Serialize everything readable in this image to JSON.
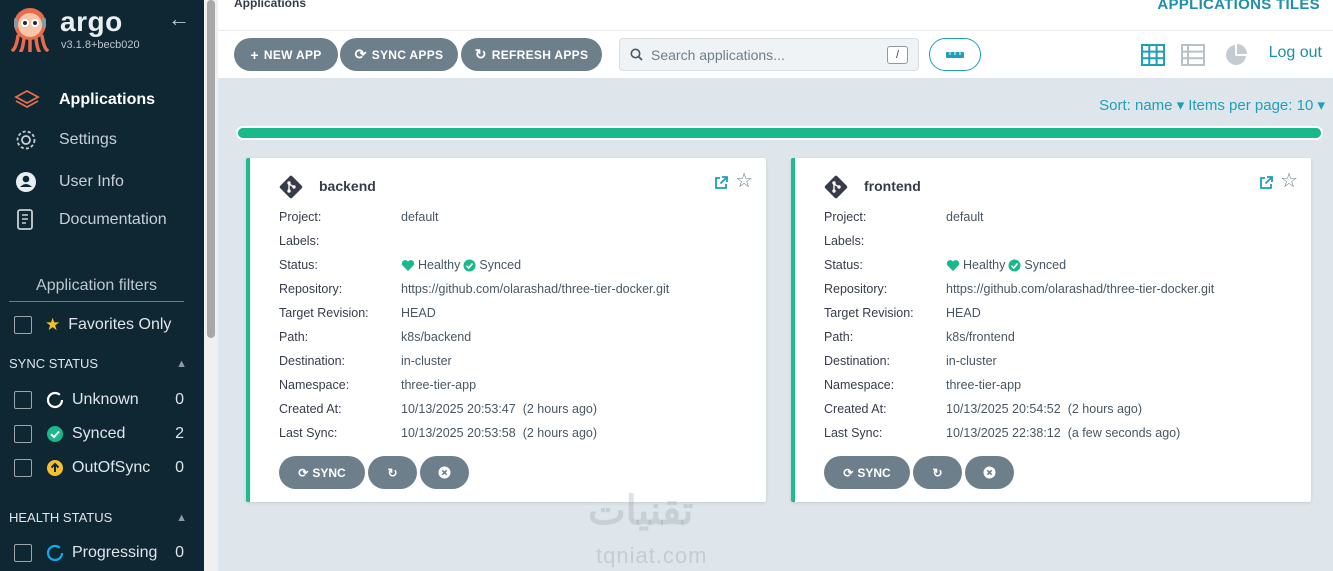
{
  "brand": {
    "name": "argo",
    "version": "v3.1.8+becb020"
  },
  "nav": [
    {
      "label": "Applications",
      "icon": "layers-icon",
      "active": true
    },
    {
      "label": "Settings",
      "icon": "gear-icon",
      "active": false
    },
    {
      "label": "User Info",
      "icon": "user-icon",
      "active": false
    },
    {
      "label": "Documentation",
      "icon": "book-icon",
      "active": false
    }
  ],
  "filters": {
    "title": "Application filters",
    "favorites_label": "Favorites Only",
    "sync_status": {
      "heading": "SYNC STATUS",
      "items": [
        {
          "label": "Unknown",
          "count": "0"
        },
        {
          "label": "Synced",
          "count": "2"
        },
        {
          "label": "OutOfSync",
          "count": "0"
        }
      ]
    },
    "health_status": {
      "heading": "HEALTH STATUS",
      "items": [
        {
          "label": "Progressing",
          "count": "0"
        }
      ]
    }
  },
  "header": {
    "breadcrumb": "Applications",
    "title": "APPLICATIONS TILES",
    "logout": "Log out"
  },
  "toolbar": {
    "new_app": "NEW APP",
    "sync_apps": "SYNC APPS",
    "refresh_apps": "REFRESH APPS",
    "search_placeholder": "Search applications...",
    "search_shortcut": "/"
  },
  "sort": {
    "sort_label": "Sort: name",
    "items_label": "Items per page: 10"
  },
  "progress": {
    "healthy_fraction": 1.0
  },
  "card_labels": {
    "project": "Project:",
    "labels": "Labels:",
    "status": "Status:",
    "repository": "Repository:",
    "target_revision": "Target Revision:",
    "path": "Path:",
    "destination": "Destination:",
    "namespace": "Namespace:",
    "created_at": "Created At:",
    "last_sync": "Last Sync:",
    "sync_button": "SYNC"
  },
  "apps": [
    {
      "name": "backend",
      "project": "default",
      "labels": "",
      "health": "Healthy",
      "sync": "Synced",
      "repository": "https://github.com/olarashad/three-tier-docker.git",
      "target_revision": "HEAD",
      "path": "k8s/backend",
      "destination": "in-cluster",
      "namespace": "three-tier-app",
      "created_at": "10/13/2025 20:53:47",
      "created_ago": "(2 hours ago)",
      "last_sync": "10/13/2025 20:53:58",
      "last_sync_ago": "(2 hours ago)"
    },
    {
      "name": "frontend",
      "project": "default",
      "labels": "",
      "health": "Healthy",
      "sync": "Synced",
      "repository": "https://github.com/olarashad/three-tier-docker.git",
      "target_revision": "HEAD",
      "path": "k8s/frontend",
      "destination": "in-cluster",
      "namespace": "three-tier-app",
      "created_at": "10/13/2025 20:54:52",
      "created_ago": "(2 hours ago)",
      "last_sync": "10/13/2025 22:38:12",
      "last_sync_ago": "(a few seconds ago)"
    }
  ],
  "watermark": {
    "text": "تقنيات",
    "subtext": "tqniat.com"
  },
  "colors": {
    "sidebar": "#0f2733",
    "accent": "#1f9fb8",
    "healthy": "#19b98c",
    "button": "#6d7f8b",
    "out_of_sync": "#f4c030",
    "progressing": "#0dadea"
  }
}
